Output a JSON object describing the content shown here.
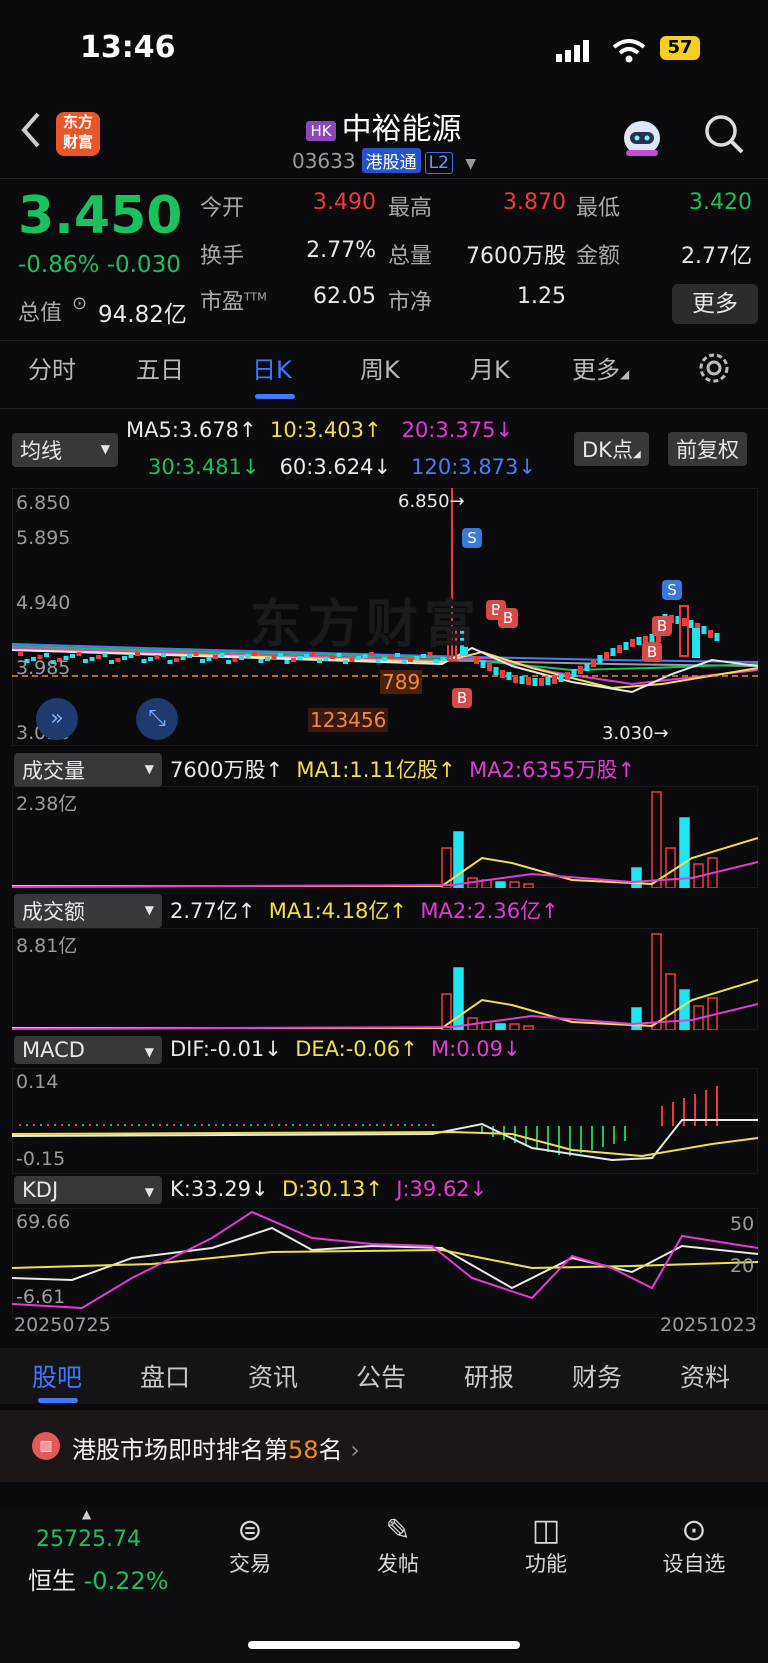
{
  "status": {
    "time": "13:46",
    "battery": "57"
  },
  "header": {
    "logo_text": "东方\n财富",
    "market_badge": "HK",
    "name": "中裕能源",
    "code": "03633",
    "tag1": "港股通",
    "tag2": "L2"
  },
  "quote": {
    "price": "3.450",
    "change_pct": "-0.86%",
    "change": "-0.030",
    "market_cap_label": "总值",
    "market_cap": "94.82亿",
    "fields": [
      {
        "label": "今开",
        "value": "3.490",
        "color": "#f03a3a"
      },
      {
        "label": "最高",
        "value": "3.870",
        "color": "#f03a3a"
      },
      {
        "label": "最低",
        "value": "3.420",
        "color": "#19c15f"
      },
      {
        "label": "换手",
        "value": "2.77%",
        "color": "#e8e8e8"
      },
      {
        "label": "总量",
        "value": "7600万股",
        "color": "#e8e8e8"
      },
      {
        "label": "金额",
        "value": "2.77亿",
        "color": "#e8e8e8"
      },
      {
        "label": "市盈",
        "sup": "TTM",
        "value": "62.05",
        "color": "#e8e8e8"
      },
      {
        "label": "市净",
        "value": "1.25",
        "color": "#e8e8e8"
      }
    ],
    "more_button": "更多"
  },
  "tabs": [
    "分时",
    "五日",
    "日K",
    "周K",
    "月K",
    "更多"
  ],
  "active_tab": "日K",
  "ma_row": {
    "selector": "均线",
    "ma5": "MA5:3.678",
    "ma10": "10:3.403",
    "ma20": "20:3.375",
    "ma30": "30:3.481",
    "ma60": "60:3.624",
    "ma120": "120:3.873",
    "dk_button": "DK点",
    "fq_button": "前复权"
  },
  "kline": {
    "y_labels": [
      "6.850",
      "5.895",
      "4.940",
      "3.985",
      "3.030"
    ],
    "high_marker": "6.850→",
    "low_marker": "3.030→",
    "watermark": "东方财富",
    "seq_789": "789",
    "seq_123456": "123456",
    "colors": {
      "up": "#f03a3a",
      "down": "#20e4f0",
      "ma5": "#e8e8e8",
      "ma10": "#f0e04a",
      "ma20": "#e53ad8",
      "ma30": "#19c15f",
      "ma60": "#9a9aa0",
      "ma120": "#4e7bf0"
    }
  },
  "volume": {
    "selector": "成交量",
    "value": "7600万股",
    "ma1": "MA1:1.11亿股",
    "ma2": "MA2:6355万股",
    "max_label": "2.38亿"
  },
  "amount": {
    "selector": "成交额",
    "value": "2.77亿",
    "ma1": "MA1:4.18亿",
    "ma2": "MA2:2.36亿",
    "max_label": "8.81亿"
  },
  "macd": {
    "selector": "MACD",
    "dif": "DIF:-0.01",
    "dea": "DEA:-0.06",
    "m": "M:0.09",
    "top_label": "0.14",
    "bottom_label": "-0.15"
  },
  "kdj": {
    "selector": "KDJ",
    "k": "K:33.29",
    "d": "D:30.13",
    "j": "J:39.62",
    "top_label": "69.66",
    "bottom_label": "-6.61",
    "ref50": "50",
    "ref20": "20",
    "date_start": "20250725",
    "date_end": "20251023"
  },
  "bottom_tabs": [
    "股吧",
    "盘口",
    "资讯",
    "公告",
    "研报",
    "财务",
    "资料"
  ],
  "rank": {
    "prefix": "港股市场即时排名第",
    "rank": "58",
    "suffix": "名"
  },
  "nav": {
    "index_value": "25725.74",
    "index_name": "恒生",
    "index_change": "-0.22%",
    "items": [
      "交易",
      "发帖",
      "功能",
      "设自选"
    ]
  }
}
